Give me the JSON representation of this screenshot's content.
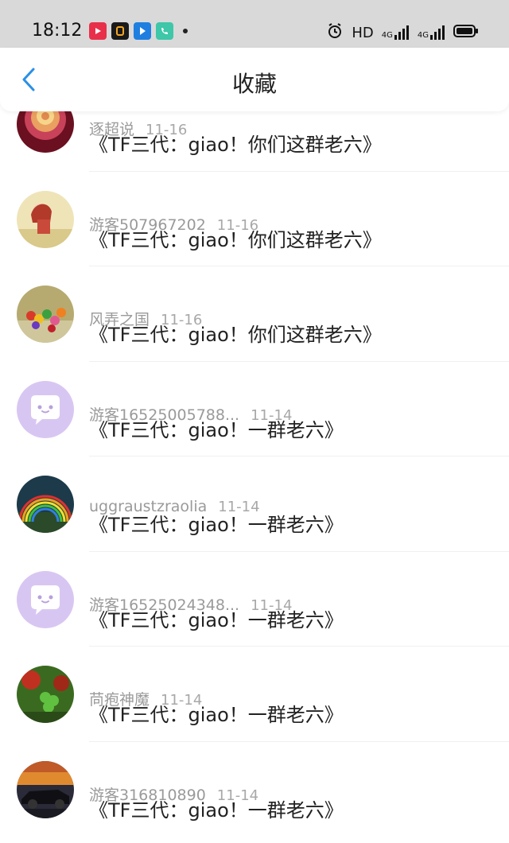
{
  "status_bar": {
    "time": "18:12",
    "app_icons": [
      {
        "name": "video-app-icon",
        "color": "#e8304a"
      },
      {
        "name": "orange-app-icon",
        "color": "#1a1a1a"
      },
      {
        "name": "blue-app-icon",
        "color": "#1e7fe0"
      },
      {
        "name": "phone-app-icon",
        "color": "#3ec7a8"
      }
    ],
    "hd_label": "HD",
    "network_label_1": "4G",
    "network_label_2": "4G"
  },
  "header": {
    "title": "收藏",
    "accent_color": "#2b8fe6"
  },
  "items": [
    {
      "user": "逐超说",
      "date": "11-16",
      "title": "《TF三代：giao！你们这群老六》",
      "avatar": "rose"
    },
    {
      "user": "游客507967202",
      "date": "11-16",
      "title": "《TF三代：giao！你们这群老六》",
      "avatar": "girl"
    },
    {
      "user": "风弄之国",
      "date": "11-16",
      "title": "《TF三代：giao！你们这群老六》",
      "avatar": "candy"
    },
    {
      "user": "游客16525005788...",
      "date": "11-14",
      "title": "《TF三代：giao！一群老六》",
      "avatar": "default"
    },
    {
      "user": "uggraustzraolia",
      "date": "11-14",
      "title": "《TF三代：giao！一群老六》",
      "avatar": "rainbow"
    },
    {
      "user": "游客16525024348...",
      "date": "11-14",
      "title": "《TF三代：giao！一群老六》",
      "avatar": "default"
    },
    {
      "user": "苘疱神魔",
      "date": "11-14",
      "title": "《TF三代：giao！一群老六》",
      "avatar": "clover"
    },
    {
      "user": "游客316810890",
      "date": "11-14",
      "title": "《TF三代：giao！一群老六》",
      "avatar": "car"
    }
  ]
}
